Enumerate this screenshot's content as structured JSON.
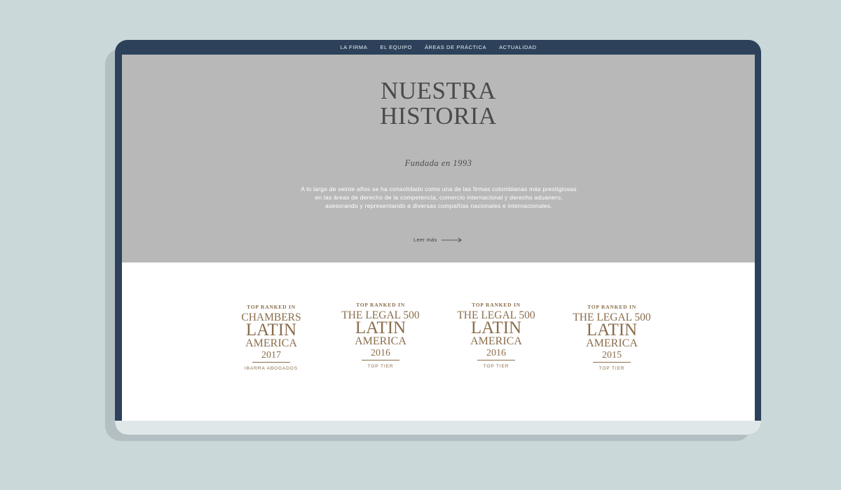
{
  "nav": {
    "items": [
      {
        "label": "LA FIRMA"
      },
      {
        "label": "EL EQUIPO"
      },
      {
        "label": "ÁREAS DE PRÁCTICA"
      },
      {
        "label": "ACTUALIDAD"
      }
    ]
  },
  "hero": {
    "title_line1": "NUESTRA",
    "title_line2": "HISTORIA",
    "subtitle": "Fundada en 1993",
    "text_lines": [
      "A lo largo de veinte años se ha consolidado como una de las firmas colombianas más prestigiosas",
      "en las áreas de derecho de la competencia, comercio internacional y derecho aduanero,",
      "asesorando y representando a diversas compañías nacionales e internacionales."
    ],
    "read_more": "Leer más",
    "read_more_icon": "arrow-right-icon"
  },
  "awards": [
    {
      "top": "TOP RANKED IN",
      "org": "CHAMBERS",
      "latin": "LATIN",
      "america": "AMERICA",
      "year": "2017",
      "foot": "IBARRA ABOGADOS"
    },
    {
      "top": "TOP RANKED IN",
      "org": "THE LEGAL 500",
      "latin": "LATIN",
      "america": "AMERICA",
      "year": "2016",
      "foot": "TOP TIER"
    },
    {
      "top": "TOP RANKED IN",
      "org": "THE LEGAL 500",
      "latin": "LATIN",
      "america": "AMERICA",
      "year": "2016",
      "foot": "TOP TIER"
    },
    {
      "top": "TOP RANKED IN",
      "org": "THE LEGAL 500",
      "latin": "LATIN",
      "america": "AMERICA",
      "year": "2015",
      "foot": "TOP TIER"
    }
  ],
  "colors": {
    "background": "#cbd8da",
    "frame": "#2d425a",
    "hero_bg": "#b8b8b8",
    "badge_gold": "#8a6d4b"
  }
}
